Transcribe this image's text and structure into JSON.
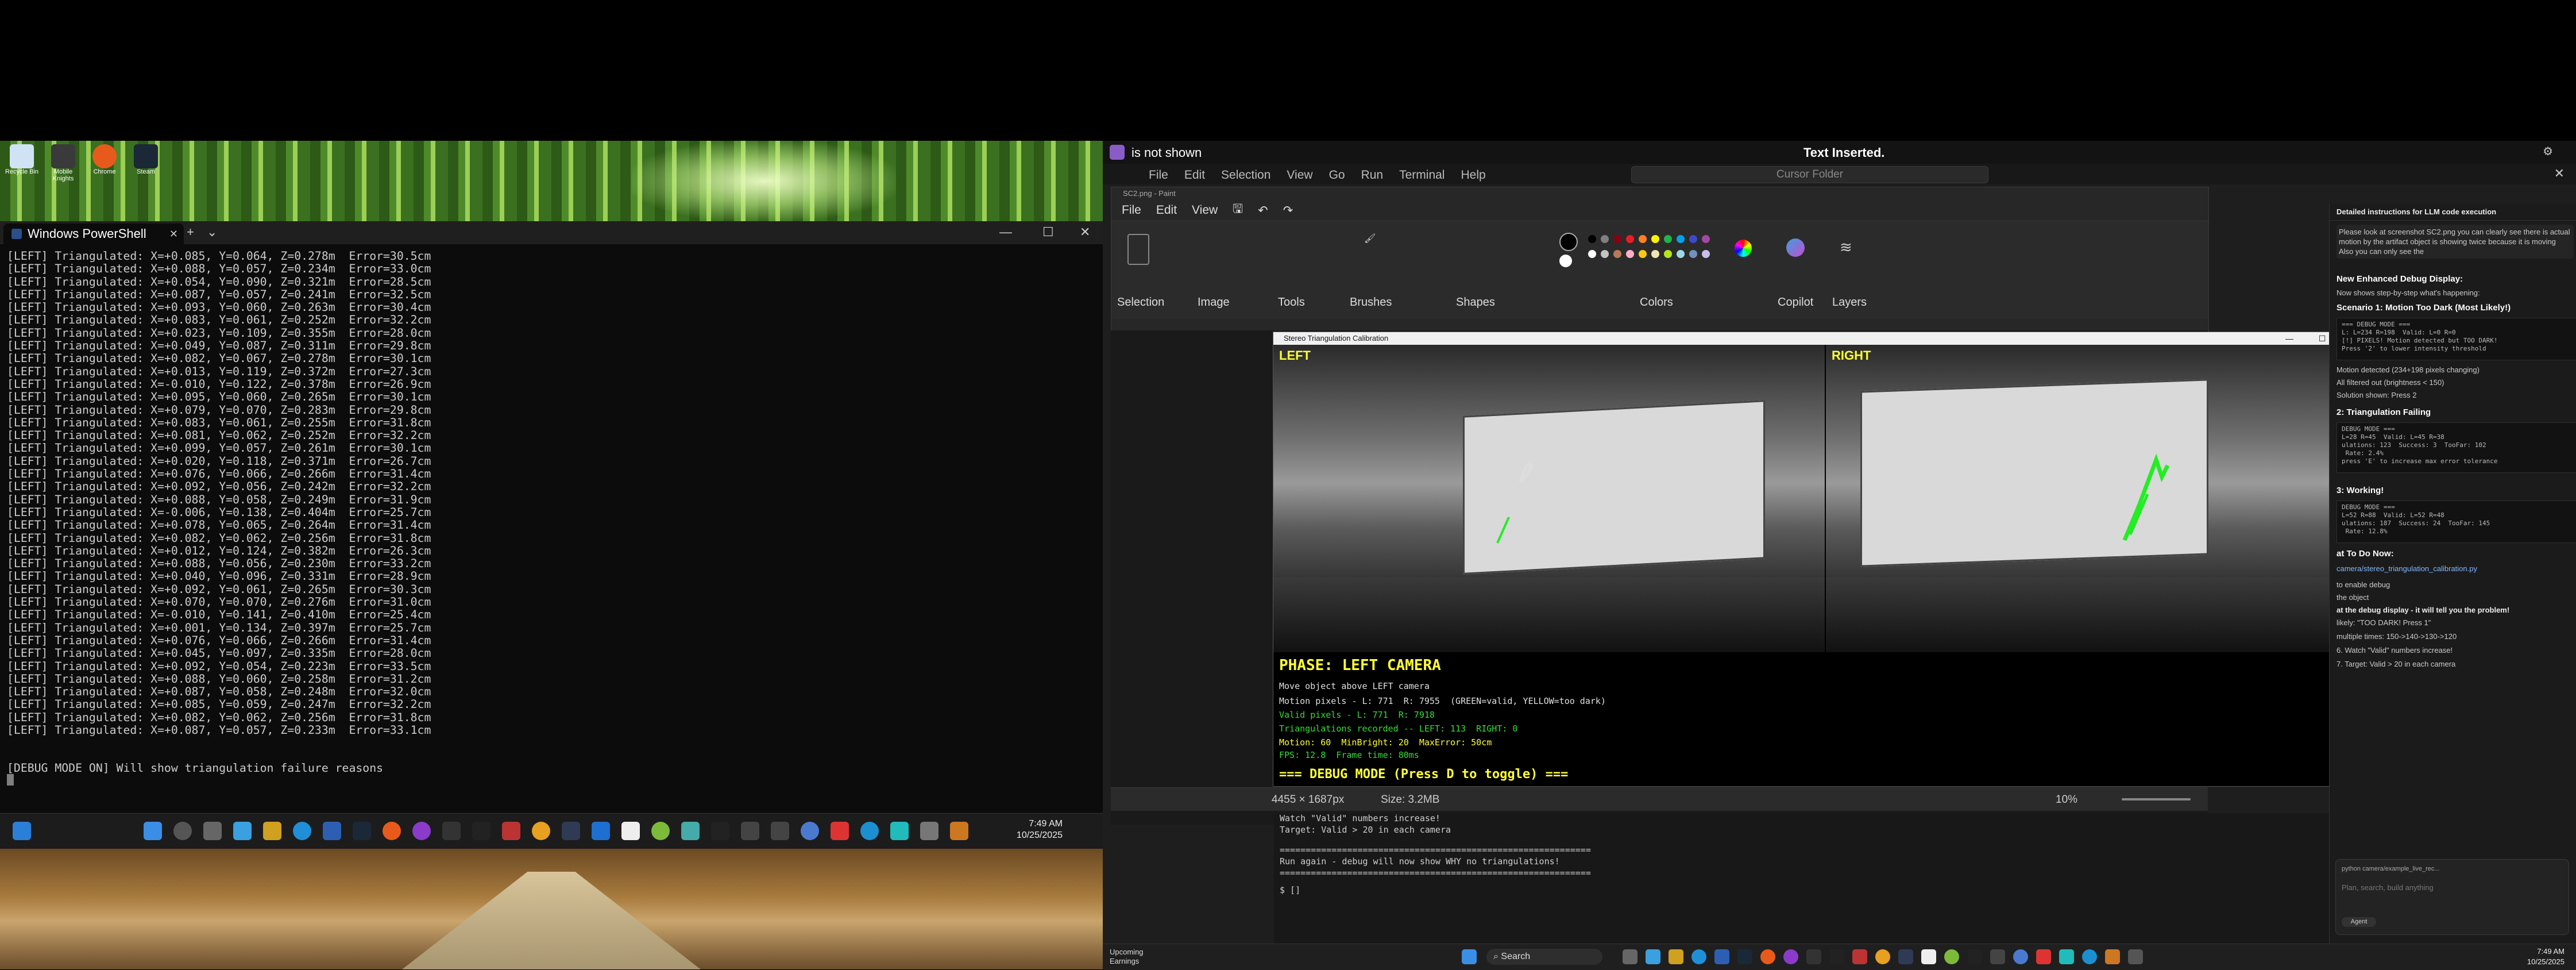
{
  "left_monitor": {
    "desktop_icons": [
      {
        "label": "Recycle Bin"
      },
      {
        "label": "Mobile Knights"
      },
      {
        "label": "Chrome"
      },
      {
        "label": "Steam"
      }
    ],
    "powershell": {
      "tab_title": "Windows PowerShell",
      "log_lines": [
        "[LEFT] Triangulated: X=+0.085, Y=0.064, Z=0.278m  Error=30.5cm",
        "[LEFT] Triangulated: X=+0.088, Y=0.057, Z=0.234m  Error=33.0cm",
        "[LEFT] Triangulated: X=+0.054, Y=0.090, Z=0.321m  Error=28.5cm",
        "[LEFT] Triangulated: X=+0.087, Y=0.057, Z=0.241m  Error=32.5cm",
        "[LEFT] Triangulated: X=+0.093, Y=0.060, Z=0.263m  Error=30.4cm",
        "[LEFT] Triangulated: X=+0.083, Y=0.061, Z=0.252m  Error=32.2cm",
        "[LEFT] Triangulated: X=+0.023, Y=0.109, Z=0.355m  Error=28.0cm",
        "[LEFT] Triangulated: X=+0.049, Y=0.087, Z=0.311m  Error=29.8cm",
        "[LEFT] Triangulated: X=+0.082, Y=0.067, Z=0.278m  Error=30.1cm",
        "[LEFT] Triangulated: X=+0.013, Y=0.119, Z=0.372m  Error=27.3cm",
        "[LEFT] Triangulated: X=-0.010, Y=0.122, Z=0.378m  Error=26.9cm",
        "[LEFT] Triangulated: X=+0.095, Y=0.060, Z=0.265m  Error=30.1cm",
        "[LEFT] Triangulated: X=+0.079, Y=0.070, Z=0.283m  Error=29.8cm",
        "[LEFT] Triangulated: X=+0.083, Y=0.061, Z=0.255m  Error=31.8cm",
        "[LEFT] Triangulated: X=+0.081, Y=0.062, Z=0.252m  Error=32.2cm",
        "[LEFT] Triangulated: X=+0.099, Y=0.057, Z=0.261m  Error=30.1cm",
        "[LEFT] Triangulated: X=+0.020, Y=0.118, Z=0.371m  Error=26.7cm",
        "[LEFT] Triangulated: X=+0.076, Y=0.066, Z=0.266m  Error=31.4cm",
        "[LEFT] Triangulated: X=+0.092, Y=0.056, Z=0.242m  Error=32.2cm",
        "[LEFT] Triangulated: X=+0.088, Y=0.058, Z=0.249m  Error=31.9cm",
        "[LEFT] Triangulated: X=-0.006, Y=0.138, Z=0.404m  Error=25.7cm",
        "[LEFT] Triangulated: X=+0.078, Y=0.065, Z=0.264m  Error=31.4cm",
        "[LEFT] Triangulated: X=+0.082, Y=0.062, Z=0.256m  Error=31.8cm",
        "[LEFT] Triangulated: X=+0.012, Y=0.124, Z=0.382m  Error=26.3cm",
        "[LEFT] Triangulated: X=+0.088, Y=0.056, Z=0.230m  Error=33.2cm",
        "[LEFT] Triangulated: X=+0.040, Y=0.096, Z=0.331m  Error=28.9cm",
        "[LEFT] Triangulated: X=+0.092, Y=0.061, Z=0.265m  Error=30.3cm",
        "[LEFT] Triangulated: X=+0.070, Y=0.070, Z=0.276m  Error=31.0cm",
        "[LEFT] Triangulated: X=-0.010, Y=0.141, Z=0.410m  Error=25.4cm",
        "[LEFT] Triangulated: X=+0.001, Y=0.134, Z=0.397m  Error=25.7cm",
        "[LEFT] Triangulated: X=+0.076, Y=0.066, Z=0.266m  Error=31.4cm",
        "[LEFT] Triangulated: X=+0.045, Y=0.097, Z=0.335m  Error=28.0cm",
        "[LEFT] Triangulated: X=+0.092, Y=0.054, Z=0.223m  Error=33.5cm",
        "[LEFT] Triangulated: X=+0.088, Y=0.060, Z=0.258m  Error=31.2cm",
        "[LEFT] Triangulated: X=+0.087, Y=0.058, Z=0.248m  Error=32.0cm",
        "[LEFT] Triangulated: X=+0.085, Y=0.059, Z=0.247m  Error=32.2cm",
        "[LEFT] Triangulated: X=+0.082, Y=0.062, Z=0.256m  Error=31.8cm",
        "[LEFT] Triangulated: X=+0.087, Y=0.057, Z=0.233m  Error=33.1cm"
      ],
      "status_line": "[DEBUG MODE ON] Will show triangulation failure reasons"
    },
    "taskbar": {
      "time": "7:49 AM",
      "date": "10/25/2025"
    }
  },
  "right_monitor": {
    "notification": {
      "left_text": "is not shown",
      "center_text": "Text Inserted."
    },
    "cursor": {
      "menu": [
        "File",
        "Edit",
        "Selection",
        "View",
        "Go",
        "Run",
        "Terminal",
        "Help"
      ],
      "search_placeholder": "Cursor Folder"
    },
    "paint": {
      "title": "SC2.png - Paint",
      "menu": [
        "File",
        "Edit",
        "View"
      ],
      "ribbon_groups": [
        "Selection",
        "Image",
        "Tools",
        "Brushes",
        "Shapes",
        "Colors",
        "Copilot",
        "Layers"
      ],
      "status_dimensions": "4455 × 1687px",
      "status_size": "Size: 3.2MB",
      "zoom": "10%",
      "colors": [
        "#000000",
        "#7f7f7f",
        "#880015",
        "#ed1c24",
        "#ff7f27",
        "#fff200",
        "#22b14c",
        "#00a2e8",
        "#3f48cc",
        "#a349a4",
        "#ffffff",
        "#c3c3c3",
        "#b97a57",
        "#ffaec9",
        "#ffc90e",
        "#efe4b0",
        "#b5e61d",
        "#99d9ea",
        "#7092be",
        "#c8bfe7"
      ]
    },
    "stereo": {
      "title": "Stereo Triangulation Calibration",
      "left_label": "LEFT",
      "right_label": "RIGHT",
      "phase": "PHASE: LEFT CAMERA",
      "lines": [
        {
          "text": "Move object above LEFT camera",
          "color": "#e0e0e0"
        },
        {
          "text": "Motion pixels - L: 771  R: 7955  (GREEN=valid, YELLOW=too dark)",
          "color": "#e0e0e0"
        },
        {
          "text": "Valid pixels - L: 771  R: 7918",
          "color": "#33dd33"
        },
        {
          "text": "Triangulations recorded -- LEFT: 113  RIGHT: 0",
          "color": "#33dd33"
        },
        {
          "text": "Motion: 60  MinBright: 20  MaxError: 50cm",
          "color": "#ffff33"
        },
        {
          "text": "FPS: 12.8  Frame time: 80ms",
          "color": "#33dd33"
        }
      ],
      "debug_toggle": "=== DEBUG MODE (Press D to toggle) ==="
    },
    "terminal": {
      "lines": [
        "Watch \"Valid\" numbers increase!",
        "Target: Valid > 20 in each camera",
        "============================================================",
        "Run again - debug will now show WHY no triangulations!",
        "============================================================",
        "$ []"
      ]
    },
    "chat": {
      "header": "Detailed instructions for LLM code execution",
      "intro": "Please look at screenshot SC2.png you can clearly see there is actual motion by the artifact object is showing twice because it is moving Also you can only see the",
      "section1": "New Enhanced Debug Display:",
      "section1_text": "Now shows step-by-step what's happening:",
      "scenario1": "Scenario 1: Motion Too Dark (Most Likely!)",
      "code1": "=== DEBUG MODE ===\nL: L=234 R=198  Valid: L=0 R=0\n[!] PIXELS! Motion detected but TOO DARK!\nPress '2' to lower intensity threshold",
      "notes1": [
        "Motion detected (234+198 pixels changing)",
        "All filtered out (brightness < 150)",
        "Solution shown: Press 2"
      ],
      "scenario2": "2: Triangulation Failing",
      "code2": "DEBUG MODE ===\nL=28 R=45  Valid: L=45 R=38\nulations: 123  Success: 3  TooFar: 102\n Rate: 2.4%\npress 'E' to increase max error tolerance",
      "scenario3": "3: Working!",
      "code3": "DEBUG MODE ===\nL=52 R=88  Valid: L=52 R=48\nulations: 187  Success: 24  TooFar: 145\n Rate: 12.8%",
      "todo_title": "at To Do Now:",
      "todo_link": "camera/stereo_triangulation_calibration.py",
      "todo": [
        "to enable debug",
        "the object",
        "at the debug display - it will tell you the problem!",
        "likely: \"TOO DARK! Press 1\"",
        "multiple times: 150->140->130->120",
        "6. Watch \"Valid\" numbers increase!",
        "7. Target: Valid > 20 in each camera"
      ],
      "input_placeholder": "Plan, search, build anything",
      "agent_label": "Agent",
      "file_ref": "python camera/example_live_rec..."
    },
    "taskbar": {
      "widget_title": "Upcoming",
      "widget_sub": "Earnings",
      "search": "Search",
      "time": "7:49 AM",
      "date": "10/25/2025"
    }
  }
}
